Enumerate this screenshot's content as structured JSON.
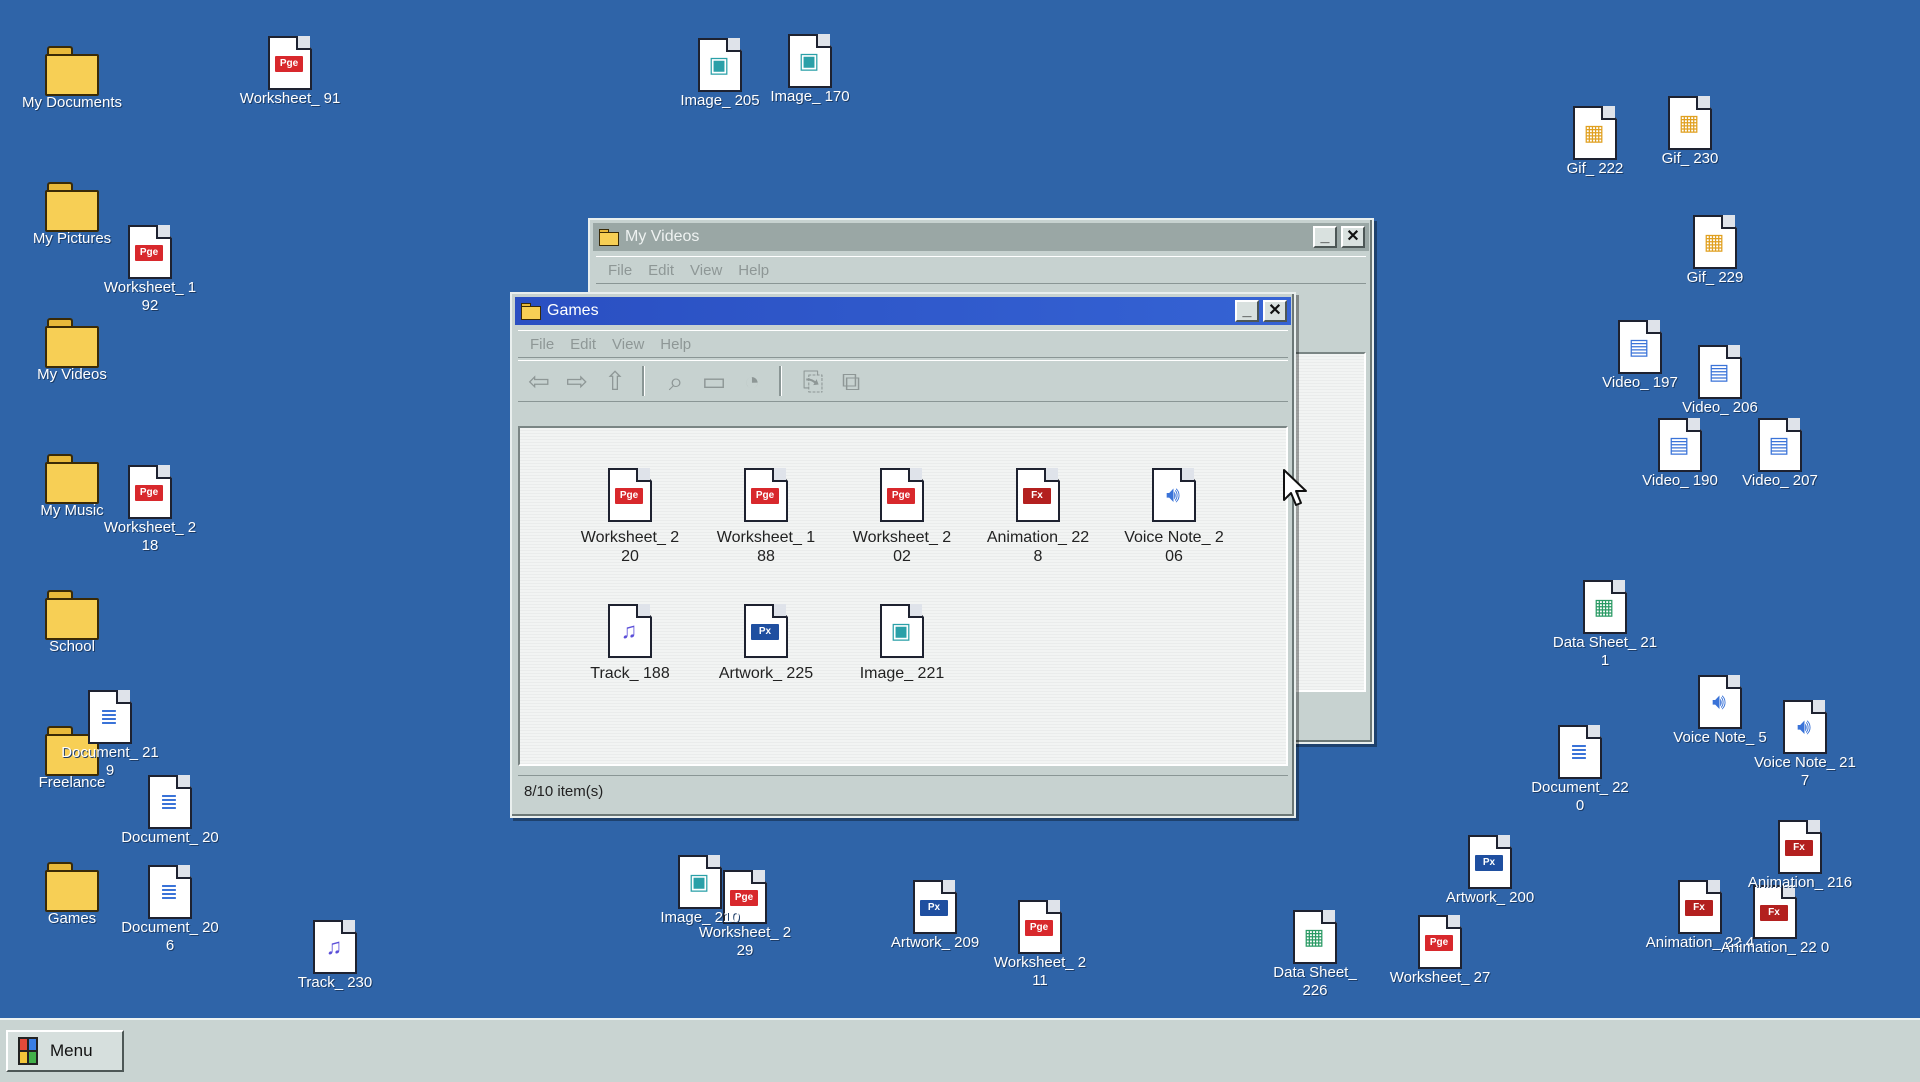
{
  "colors": {
    "desktop": "#2f64a8",
    "titlebar_active": "#2e56c6",
    "titlebar_inactive": "#9aa7a5",
    "folder": "#f7cf55",
    "pge_badge": "#d8282c",
    "fx_badge": "#b3201f",
    "px_badge": "#1f4fa0",
    "vec_badge": "#c4620c"
  },
  "desktop_shortcuts": [
    {
      "label": "My Documents",
      "icon": "folder-icon"
    },
    {
      "label": "My Pictures",
      "icon": "folder-icon"
    },
    {
      "label": "My Videos",
      "icon": "folder-icon"
    },
    {
      "label": "My Music",
      "icon": "folder-icon"
    },
    {
      "label": "School",
      "icon": "folder-icon"
    },
    {
      "label": "Freelance",
      "icon": "folder-icon"
    },
    {
      "label": "Games",
      "icon": "folder-icon"
    }
  ],
  "desktop_files": [
    {
      "label": "Worksheet_ 91",
      "kind": "pge"
    },
    {
      "label": "Image_ 205",
      "kind": "image"
    },
    {
      "label": "Image_ 170",
      "kind": "image"
    },
    {
      "label": "Worksheet_ 1 92",
      "kind": "pge"
    },
    {
      "label": "Worksheet_ 2 18",
      "kind": "pge"
    },
    {
      "label": "Document_ 21 9",
      "kind": "doc"
    },
    {
      "label": "Document_ 20",
      "kind": "doc"
    },
    {
      "label": "Document_ 20 6",
      "kind": "doc"
    },
    {
      "label": "Track_ 230",
      "kind": "audio"
    },
    {
      "label": "Gif_ 222",
      "kind": "gif"
    },
    {
      "label": "Gif_ 230",
      "kind": "gif"
    },
    {
      "label": "Gif_ 229",
      "kind": "gif"
    },
    {
      "label": "Video_ 197",
      "kind": "video"
    },
    {
      "label": "Video_ 206",
      "kind": "video"
    },
    {
      "label": "Video_ 190",
      "kind": "video"
    },
    {
      "label": "Video_ 207",
      "kind": "video"
    },
    {
      "label": "Data Sheet_ 21 1",
      "kind": "sheet"
    },
    {
      "label": "Voice Note_ 5",
      "kind": "voice"
    },
    {
      "label": "Voice Note_ 21 7",
      "kind": "voice"
    },
    {
      "label": "Document_ 22 0",
      "kind": "doc"
    },
    {
      "label": "Animation_ 22 4",
      "kind": "fx"
    },
    {
      "label": "Animation_ 22 0",
      "kind": "fx"
    },
    {
      "label": "Animation_ 216",
      "kind": "fx"
    },
    {
      "label": "Worksheet_ 2 29",
      "kind": "pge"
    },
    {
      "label": "Image_ 210",
      "kind": "image"
    },
    {
      "label": "Worksheet_ 2 11",
      "kind": "pge"
    },
    {
      "label": "Artwork_ 209",
      "kind": "px"
    },
    {
      "label": "Worksheet_ 27",
      "kind": "pge"
    },
    {
      "label": "Artwork_ 200",
      "kind": "px"
    },
    {
      "label": "Data Sheet_ 226",
      "kind": "sheet"
    }
  ],
  "window_back": {
    "title": "My Videos",
    "menu": [
      "File",
      "Edit",
      "View",
      "Help"
    ],
    "minimize_label": "_",
    "close_label": "✕"
  },
  "window_front": {
    "title": "Games",
    "menu": [
      "File",
      "Edit",
      "View",
      "Help"
    ],
    "minimize_label": "_",
    "close_label": "✕",
    "toolbar": [
      {
        "name": "back-icon",
        "glyph": "⇦"
      },
      {
        "name": "forward-icon",
        "glyph": "⇨"
      },
      {
        "name": "up-icon",
        "glyph": "⇧"
      },
      {
        "name": "search-icon",
        "glyph": "⌕"
      },
      {
        "name": "folders-icon",
        "glyph": "▭"
      },
      {
        "name": "history-icon",
        "glyph": "◔"
      },
      {
        "name": "copy-to-icon",
        "glyph": "⎘"
      },
      {
        "name": "move-to-icon",
        "glyph": "⧉"
      }
    ],
    "files": [
      {
        "line1": "Worksheet_ 2",
        "line2": "20",
        "kind": "pge",
        "badge": "Pge"
      },
      {
        "line1": "Worksheet_ 1",
        "line2": "88",
        "kind": "pge",
        "badge": "Pge"
      },
      {
        "line1": "Worksheet_ 2",
        "line2": "02",
        "kind": "pge",
        "badge": "Pge"
      },
      {
        "line1": "Animation_ 22",
        "line2": "8",
        "kind": "fx",
        "badge": "Fx"
      },
      {
        "line1": "Voice Note_ 2",
        "line2": "06",
        "kind": "voice",
        "badge": ""
      },
      {
        "line1": "Track_ 188",
        "line2": "",
        "kind": "audio",
        "badge": ""
      },
      {
        "line1": "Artwork_ 225",
        "line2": "",
        "kind": "px",
        "badge": "Px"
      },
      {
        "line1": "Image_ 221",
        "line2": "",
        "kind": "image",
        "badge": ""
      }
    ],
    "status": "8/10 item(s)"
  },
  "taskbar": {
    "start_label": "Menu"
  }
}
